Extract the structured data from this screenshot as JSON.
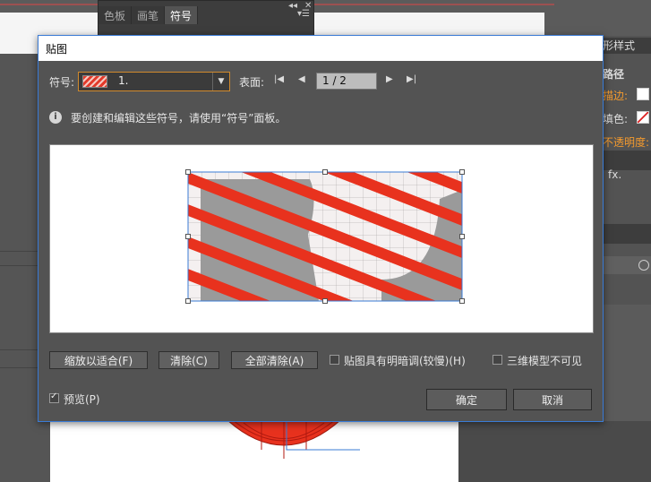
{
  "background": {
    "panel_tabs": [
      "色板",
      "画笔",
      "符号"
    ],
    "right_panel": {
      "graphic_styles_tab": "形样式",
      "path_label": "路径",
      "stroke_label": "描边:",
      "fill_label": "填色:",
      "opacity_label": "不透明度:",
      "fx_label": "fx."
    }
  },
  "dialog": {
    "title": "贴图",
    "symbol_label": "符号:",
    "symbol_value": "1.",
    "surface_label": "表面:",
    "page_value": "1 / 2",
    "info_text": "要创建和编辑这些符号，请使用“符号”面板。",
    "buttons": {
      "scale_to_fit": "缩放以适合(F)",
      "clear": "清除(C)",
      "clear_all": "全部清除(A)",
      "ok": "确定",
      "cancel": "取消"
    },
    "checkboxes": {
      "shade_artwork": {
        "label": "贴图具有明暗调(较慢)(H)",
        "checked": false
      },
      "invisible_geometry": {
        "label": "三维模型不可见",
        "checked": false
      },
      "preview": {
        "label": "预览(P)",
        "checked": true
      }
    }
  },
  "colors": {
    "accent_blue": "#3a7bd5",
    "stripe_red": "#e8321e",
    "orange_label": "#f39a2e"
  }
}
